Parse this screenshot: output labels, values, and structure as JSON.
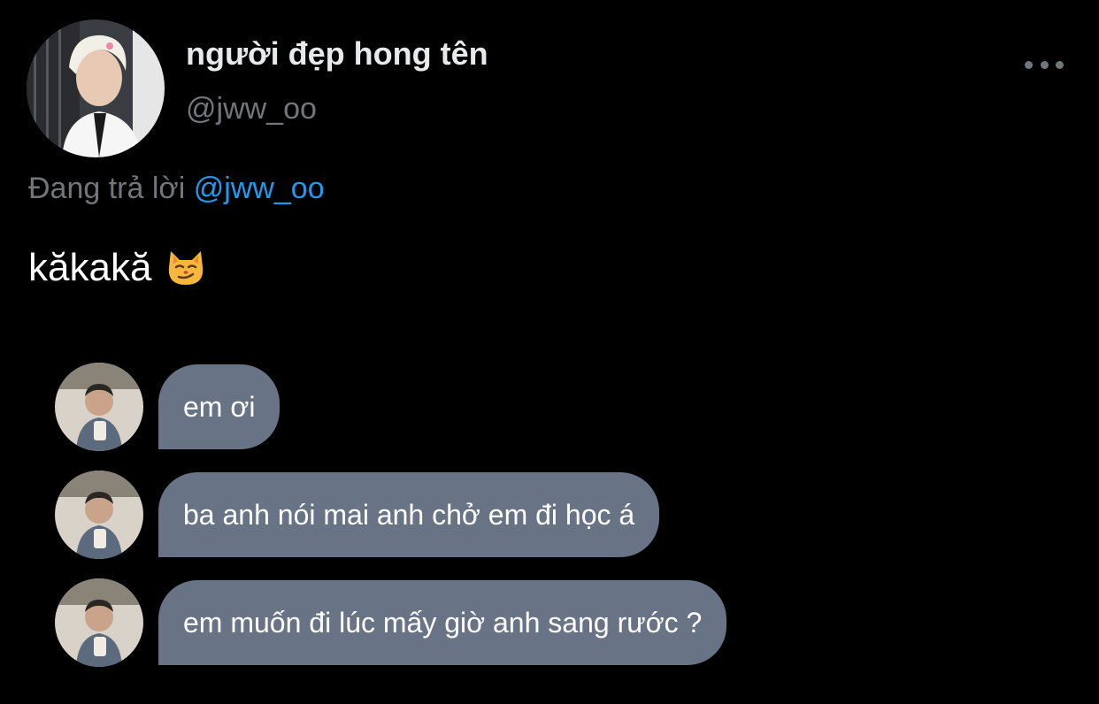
{
  "tweet": {
    "author": {
      "display_name": "người đẹp hong tên",
      "handle": "@jww_oo",
      "avatar_icon": "profile-photo"
    },
    "more_icon": "ellipsis-icon",
    "reply_prefix": "Đang trả lời",
    "reply_to": "@jww_oo",
    "text": "kăkakă",
    "emoji": "smirking-cat-face"
  },
  "chat": {
    "messages": [
      {
        "text": "em ơi"
      },
      {
        "text": "ba anh nói mai anh chở em đi học á"
      },
      {
        "text": "em muốn đi lúc mấy giờ anh sang rước ?"
      }
    ]
  },
  "colors": {
    "background": "#000000",
    "primary_text": "#e7e9ea",
    "secondary_text": "#71767b",
    "link": "#1d9bf0",
    "bubble": "#687485"
  }
}
